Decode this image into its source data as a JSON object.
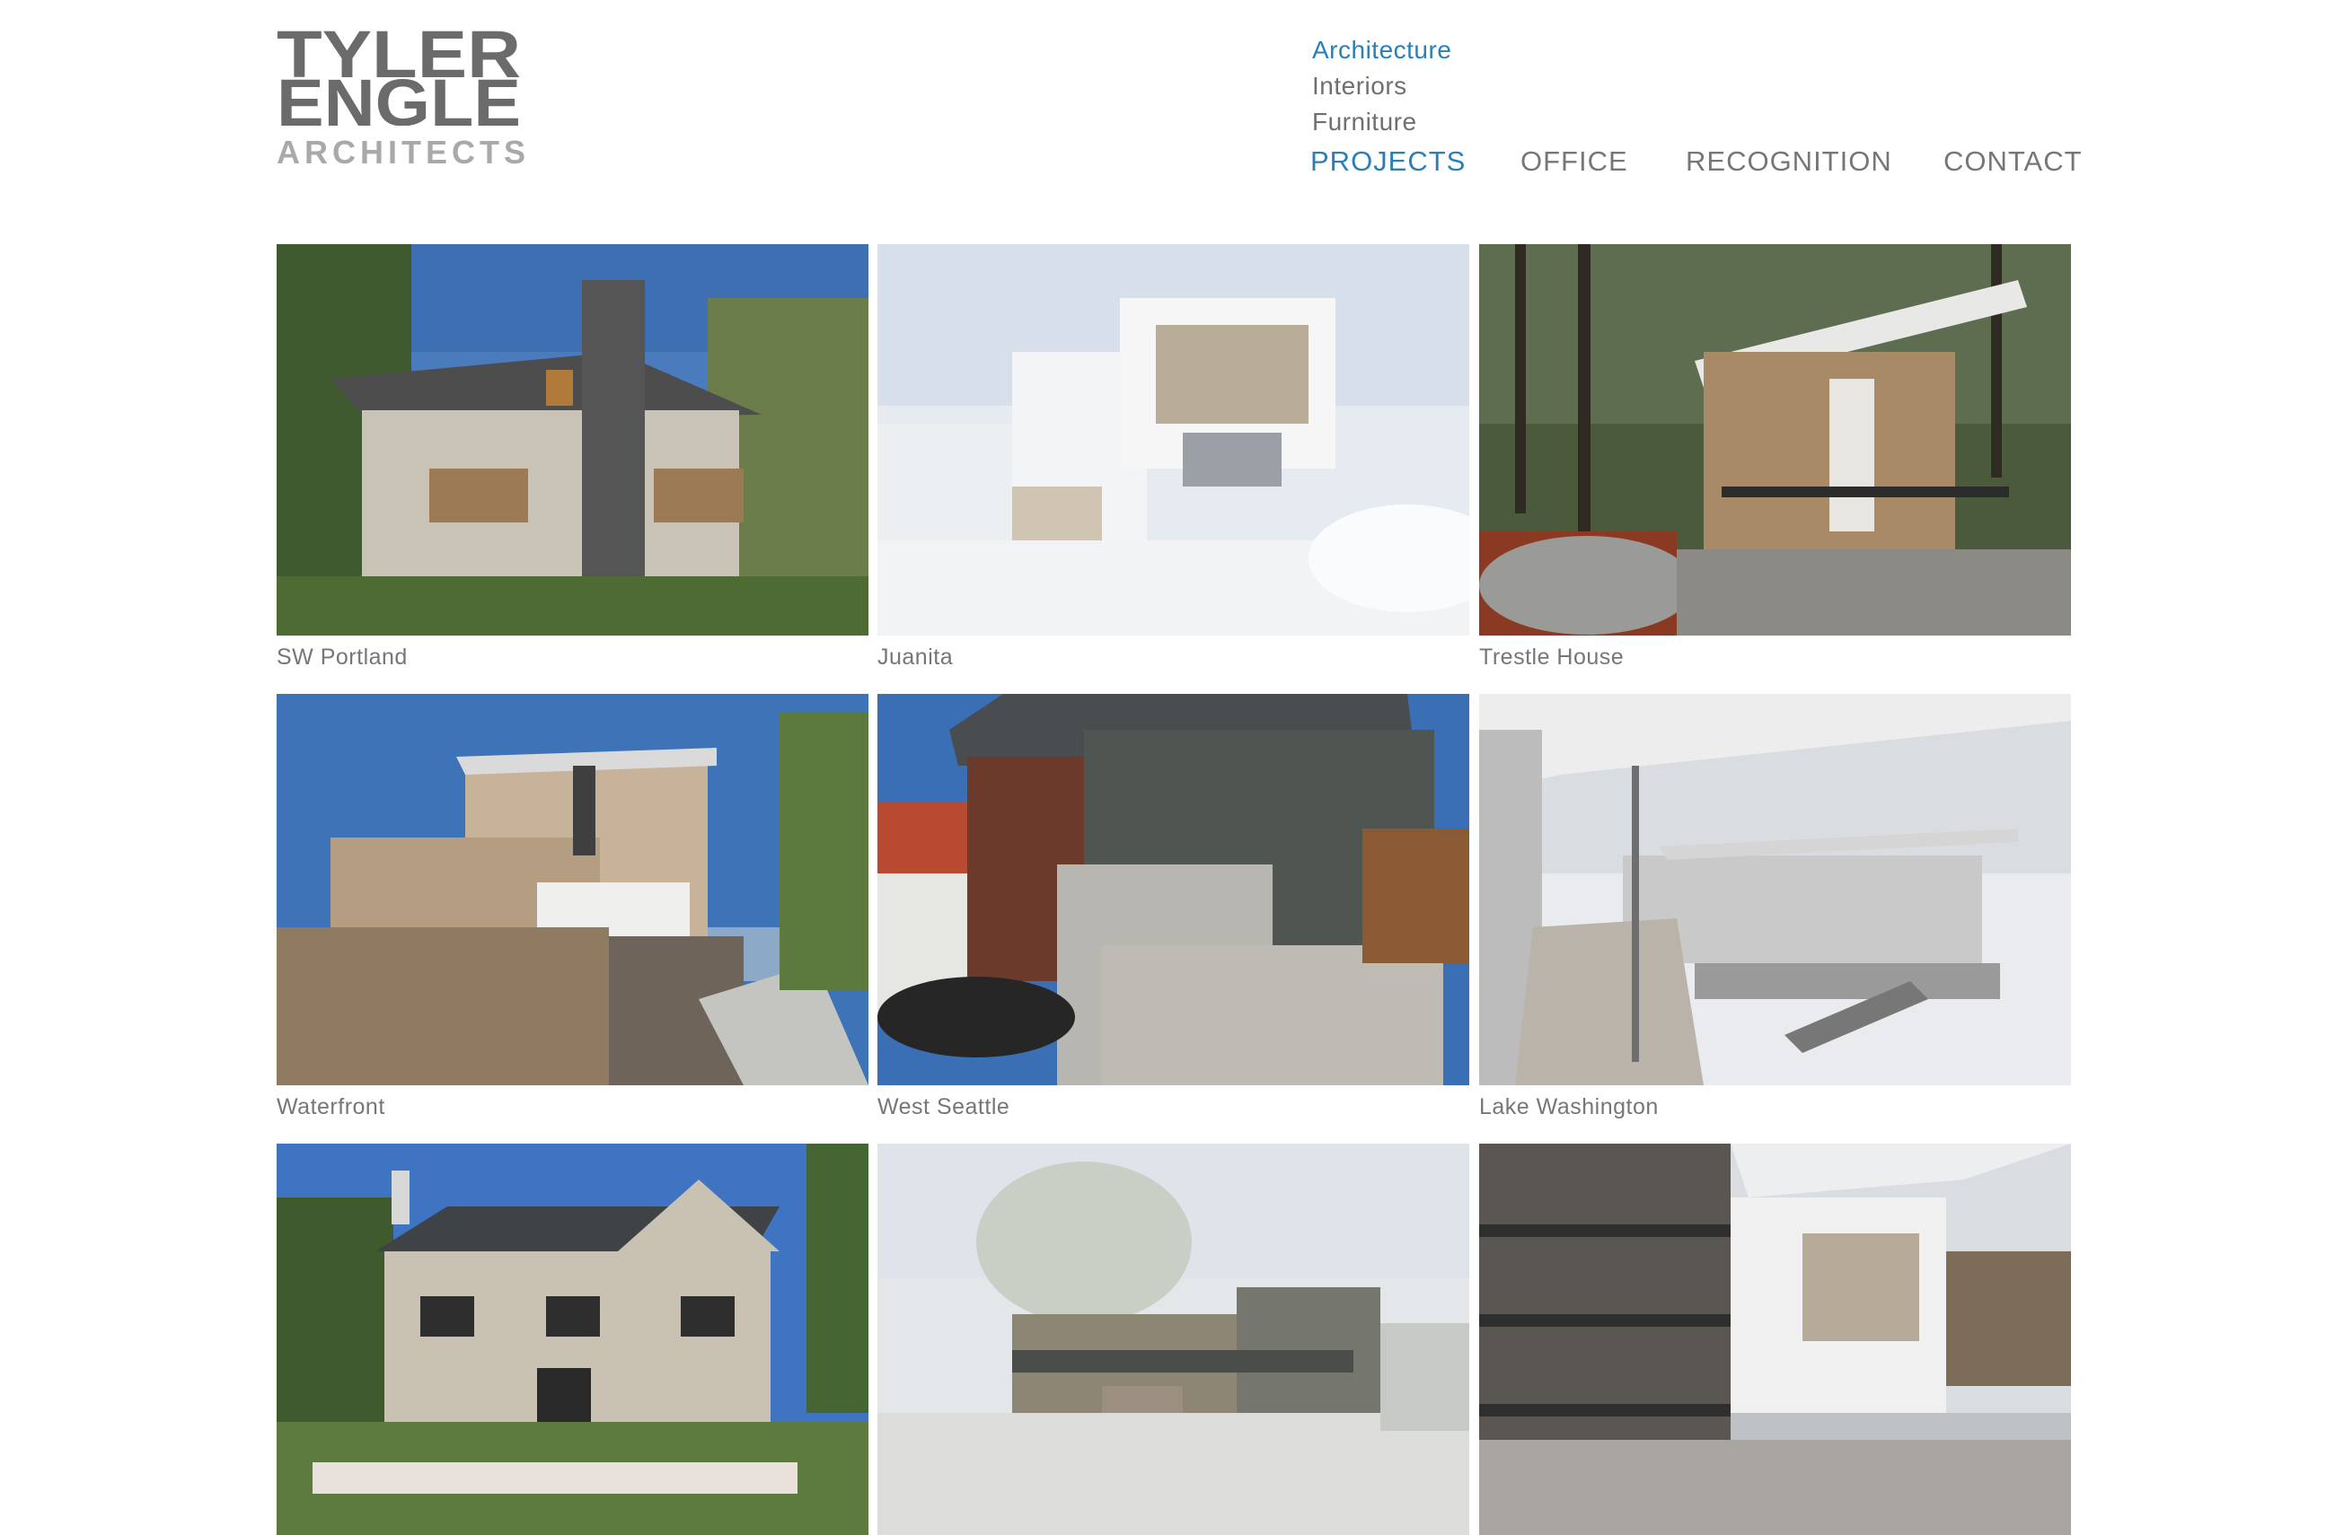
{
  "logo": {
    "line1": "TYLER",
    "line2": "ENGLE",
    "line3": "ARCHITECTS"
  },
  "subnav": [
    {
      "label": "Architecture",
      "active": true
    },
    {
      "label": "Interiors",
      "active": false
    },
    {
      "label": "Furniture",
      "active": false
    }
  ],
  "mainnav": [
    {
      "label": "PROJECTS",
      "active": true
    },
    {
      "label": "OFFICE",
      "active": false
    },
    {
      "label": "RECOGNITION",
      "active": false
    },
    {
      "label": "CONTACT",
      "active": false
    }
  ],
  "projects": [
    {
      "caption": "SW Portland"
    },
    {
      "caption": "Juanita"
    },
    {
      "caption": "Trestle House"
    },
    {
      "caption": "Waterfront"
    },
    {
      "caption": "West Seattle"
    },
    {
      "caption": "Lake Washington"
    },
    {
      "caption": ""
    },
    {
      "caption": ""
    },
    {
      "caption": ""
    }
  ],
  "colors": {
    "accent": "#2a7fb8",
    "nav_text": "#767676",
    "logo_dark": "#6b6b6b",
    "logo_light": "#a9a9a9"
  }
}
